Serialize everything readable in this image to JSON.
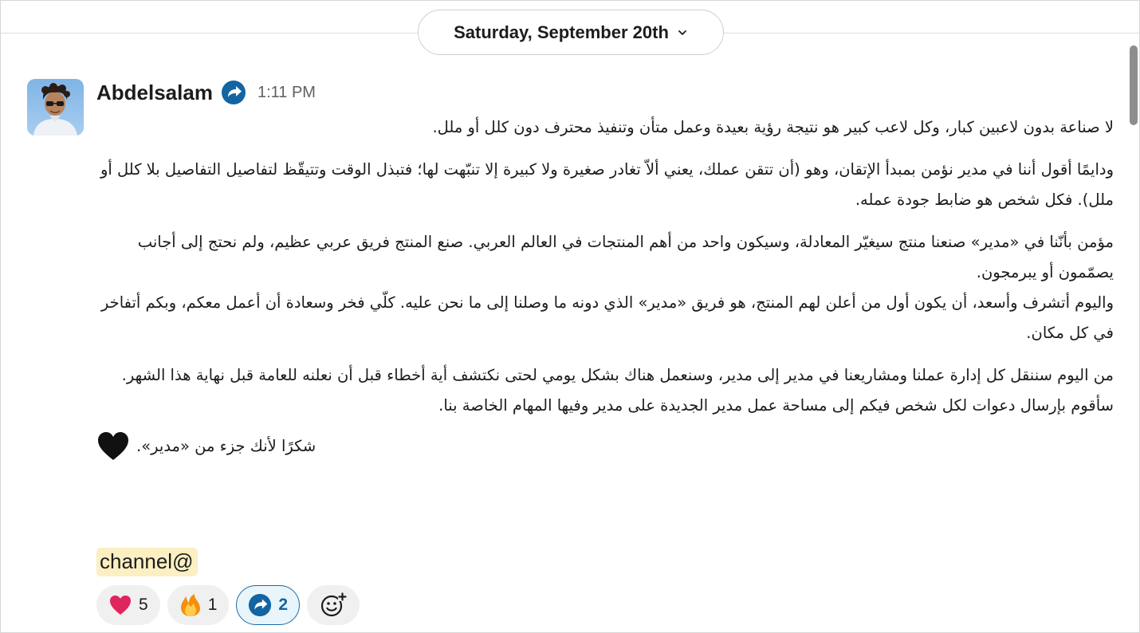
{
  "date_divider": {
    "label": "Saturday, September 20th",
    "chevron_icon": "chevron-down-icon"
  },
  "message": {
    "sender": "Abdelsalam",
    "badge_icon": "share-arrow-badge-icon",
    "timestamp": "1:11 PM",
    "paragraphs": [
      "لا صناعة بدون لاعبين كبار، وكل لاعب كبير هو نتيجة رؤية بعيدة وعمل متأن وتنفيذ محترف دون كلل أو ملل.",
      "ودايمًا أقول أننا في مدير نؤمن بمبدأ الإتقان، وهو (أن تتقن عملك، يعني ألاّ تغادر صغيرة ولا كبيرة إلا تنبّهت لها؛ فتبذل الوقت وتتيقّظ لتفاصيل التفاصيل بلا كلل أو ملل). فكل شخص هو ضابط جودة عمله.",
      "مؤمن بأنّنا في «مدير» صنعنا منتج سيغيّر المعادلة، وسيكون واحد من أهم المنتجات في العالم العربي. صنع المنتج فريق عربي عظيم، ولم نحتج إلى أجانب يصمّمون أو يبرمجون.",
      "واليوم أتشرف وأسعد، أن يكون أول من أعلن لهم المنتج، هو فريق «مدير» الذي دونه ما وصلنا إلى ما نحن عليه. كلّي فخر وسعادة أن أعمل معكم، وبكم أتفاخر في كل مكان.",
      "من اليوم سننقل كل إدارة عملنا ومشاريعنا في مدير إلى مدير، وسنعمل هناك بشكل يومي لحتى نكتشف أية أخطاء قبل أن نعلنه للعامة قبل نهاية هذا الشهر. سأقوم بإرسال دعوات لكل شخص فيكم إلى مساحة عمل مدير الجديدة على مدير وفيها المهام الخاصة بنا.",
      "شكرًا لأنك جزء من «مدير»."
    ],
    "closing_emoji": "black-heart-icon",
    "mention": "channel@"
  },
  "reactions": [
    {
      "emoji": "red-heart-icon",
      "count": "5",
      "active": false
    },
    {
      "emoji": "fire-icon",
      "count": "1",
      "active": false
    },
    {
      "emoji": "share-arrow-badge-icon",
      "count": "2",
      "active": true
    }
  ],
  "add_reaction_icon": "add-reaction-icon",
  "colors": {
    "accent": "#1264a3",
    "mention_bg": "#fcefc2",
    "heart": "#e0245e"
  }
}
